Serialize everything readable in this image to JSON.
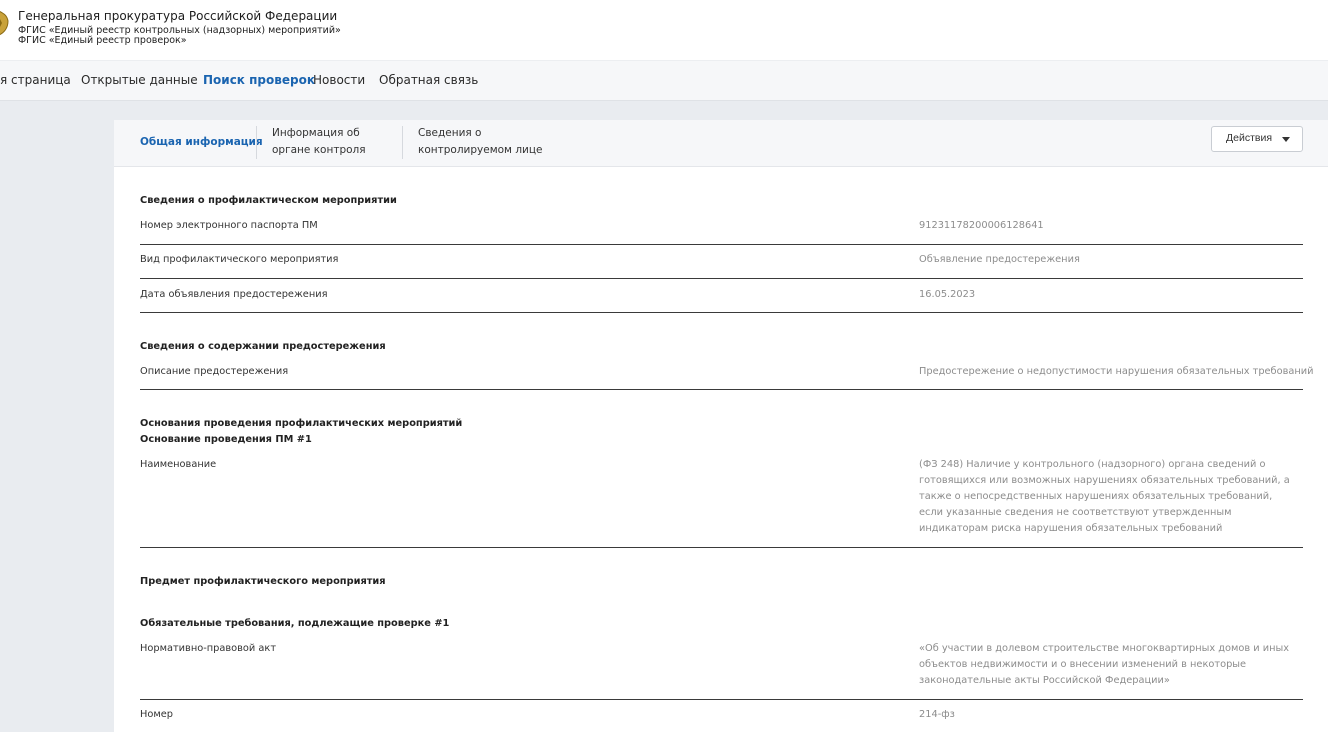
{
  "header": {
    "org_title": "Генеральная прокуратура Российской Федерации",
    "subtitle_1": "ФГИС «Единый реестр контрольных (надзорных) мероприятий»",
    "subtitle_2": "ФГИС «Единый реестр проверок»"
  },
  "topnav": {
    "items": [
      {
        "label": "я страница"
      },
      {
        "label": "Открытые данные"
      },
      {
        "label": "Поиск проверок"
      },
      {
        "label": "Новости"
      },
      {
        "label": "Обратная связь"
      }
    ],
    "active": "Поиск проверок"
  },
  "tabs": {
    "items": [
      {
        "line1": "Общая информация",
        "line2": ""
      },
      {
        "line1": "Информация об",
        "line2": "органе контроля"
      },
      {
        "line1": "Сведения о",
        "line2": "контролируемом лице"
      }
    ],
    "actions_label": "Действия"
  },
  "sections": {
    "s1_title": "Сведения о профилактическом мероприятии",
    "s1_rows": [
      {
        "label": "Номер электронного паспорта ПМ",
        "value": "91231178200006128641"
      },
      {
        "label": "Вид профилактического мероприятия",
        "value": "Объявление предостережения"
      },
      {
        "label": "Дата объявления предостережения",
        "value": "16.05.2023"
      }
    ],
    "s2_title": "Сведения о содержании предостережения",
    "s2_rows": [
      {
        "label": "Описание предостережения",
        "value": "Предостережение о недопустимости нарушения обязательных требований"
      }
    ],
    "s3_title": "Основания проведения профилактических мероприятий",
    "s3_subtitle": "Основание проведения ПМ #1",
    "s3_rows": [
      {
        "label": "Наименование",
        "value": "(ФЗ 248) Наличие у контрольного (надзорного) органа сведений о готовящихся или возможных нарушениях обязательных требований, а также о непосредственных нарушениях обязательных требований, если указанные сведения не соответствуют утвержденным индикаторам риска нарушения обязательных требований"
      }
    ],
    "s4_title": "Предмет профилактического мероприятия",
    "s5_title": "Обязательные требования, подлежащие проверке #1",
    "s5_rows": [
      {
        "label": "Нормативно-правовой акт",
        "value": "«Об участии в долевом строительстве многоквартирных домов и иных объектов недвижимости и о внесении изменений в некоторые законодательные акты Российской Федерации»"
      },
      {
        "label": "Номер",
        "value": "214-фз"
      }
    ]
  }
}
